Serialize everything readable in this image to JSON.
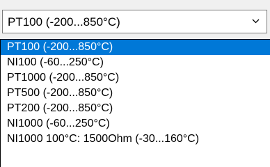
{
  "combo": {
    "value": "PT100 (-200...850°C)"
  },
  "options": [
    "PT100 (-200...850°C)",
    "NI100 (-60...250°C)",
    "PT1000 (-200...850°C)",
    "PT500 (-200...850°C)",
    "PT200 (-200...850°C)",
    "NI1000 (-60...250°C)",
    "NI1000 100°C: 1500Ohm (-30...160°C)"
  ],
  "selected_index": 0,
  "colors": {
    "selection": "#0078d7",
    "selection_text": "#ffffff",
    "border": "#7a7a7a"
  },
  "icons": {
    "dropdown": "chevron-down-icon"
  }
}
